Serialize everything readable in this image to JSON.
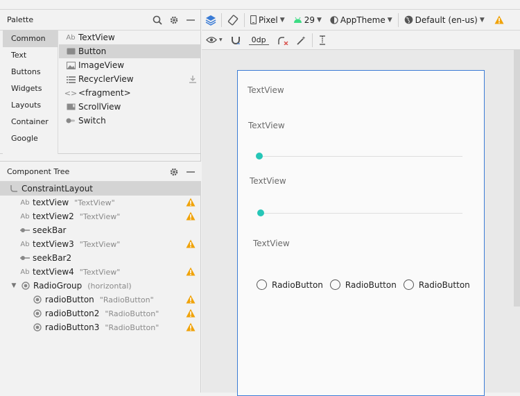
{
  "palette": {
    "title": "Palette",
    "categories": [
      "Common",
      "Text",
      "Buttons",
      "Widgets",
      "Layouts",
      "Container",
      "Google"
    ],
    "widgets": [
      {
        "label": "TextView",
        "icon": "text-view-icon"
      },
      {
        "label": "Button",
        "icon": "button-icon"
      },
      {
        "label": "ImageView",
        "icon": "image-view-icon"
      },
      {
        "label": "RecyclerView",
        "icon": "recycler-view-icon"
      },
      {
        "label": "<fragment>",
        "icon": "fragment-icon"
      },
      {
        "label": "ScrollView",
        "icon": "scroll-view-icon"
      },
      {
        "label": "Switch",
        "icon": "switch-icon"
      }
    ]
  },
  "component_tree": {
    "title": "Component Tree",
    "items": [
      {
        "name": "ConstraintLayout",
        "value": "",
        "warn": false
      },
      {
        "name": "textView",
        "value": "\"TextView\"",
        "warn": true
      },
      {
        "name": "textView2",
        "value": "\"TextView\"",
        "warn": true
      },
      {
        "name": "seekBar",
        "value": "",
        "warn": false
      },
      {
        "name": "textView3",
        "value": "\"TextView\"",
        "warn": true
      },
      {
        "name": "seekBar2",
        "value": "",
        "warn": false
      },
      {
        "name": "textView4",
        "value": "\"TextView\"",
        "warn": true
      },
      {
        "name": "RadioGroup",
        "value": "(horizontal)",
        "warn": false
      },
      {
        "name": "radioButton",
        "value": "\"RadioButton\"",
        "warn": true
      },
      {
        "name": "radioButton2",
        "value": "\"RadioButton\"",
        "warn": true
      },
      {
        "name": "radioButton3",
        "value": "\"RadioButton\"",
        "warn": true
      }
    ]
  },
  "toolbar": {
    "device": "Pixel",
    "api": "29",
    "theme": "AppTheme",
    "locale": "Default (en-us)",
    "margin": "0dp"
  },
  "preview": {
    "text1": "TextView",
    "text2": "TextView",
    "text3": "TextView",
    "text4": "TextView",
    "radio1": "RadioButton",
    "radio2": "RadioButton",
    "radio3": "RadioButton"
  },
  "colors": {
    "accent": "#26c6b7",
    "warning": "#f0a30a",
    "selection": "#3a7bd5"
  }
}
